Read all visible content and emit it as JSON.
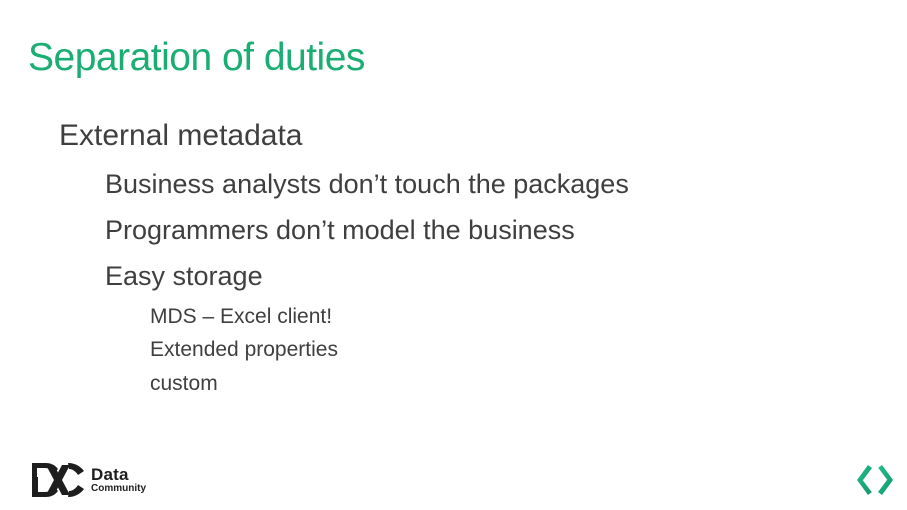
{
  "slide": {
    "title": "Separation of duties",
    "bullets": [
      {
        "level": 1,
        "text": "External metadata",
        "children": [
          {
            "level": 2,
            "text": "Business analysts don’t touch the packages"
          },
          {
            "level": 2,
            "text": "Programmers don’t model the business"
          },
          {
            "level": 2,
            "text": "Easy storage",
            "children": [
              {
                "level": 3,
                "text": "MDS – Excel client!"
              },
              {
                "level": 3,
                "text": "Extended properties"
              },
              {
                "level": 3,
                "text": "custom"
              }
            ]
          }
        ]
      }
    ]
  },
  "footer": {
    "logo": {
      "icon": "dc-logo-icon",
      "line1": "Data",
      "line2": "Community"
    },
    "nav_icon": "code-brackets-icon"
  },
  "colors": {
    "title": "#1aae73",
    "body_text": "#3f3f3f",
    "logo": "#1e1e1e",
    "accent_arrows": "#1fb07a"
  }
}
